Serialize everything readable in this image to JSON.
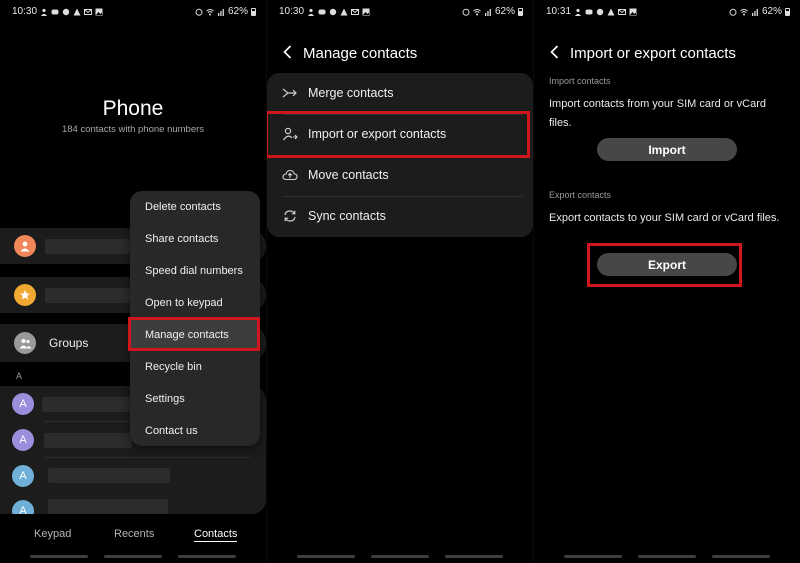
{
  "status": {
    "p1_time": "10:30",
    "p2_time": "10:30",
    "p3_time": "10:31",
    "battery": "62%"
  },
  "contacts_screen": {
    "title": "Phone",
    "subtitle": "184 contacts with phone numbers",
    "groups_label": "Groups",
    "section_letter": "A",
    "avatar_letter": "A",
    "popup_menu": {
      "items": [
        "Delete contacts",
        "Share contacts",
        "Speed dial numbers",
        "Open to keypad",
        "Manage contacts",
        "Recycle bin",
        "Settings",
        "Contact us"
      ],
      "highlighted_index": 4
    },
    "bottom_tabs": [
      "Keypad",
      "Recents",
      "Contacts"
    ],
    "active_tab": "Contacts"
  },
  "manage_contacts": {
    "title": "Manage contacts",
    "items": [
      {
        "label": "Merge contacts",
        "icon": "merge-icon"
      },
      {
        "label": "Import or export contacts",
        "icon": "import-export-icon"
      },
      {
        "label": "Move contacts",
        "icon": "cloud-upload-icon"
      },
      {
        "label": "Sync contacts",
        "icon": "sync-icon"
      }
    ]
  },
  "import_export": {
    "title": "Import or export contacts",
    "import_section_label": "Import contacts",
    "import_description": "Import contacts from your SIM card or vCard files.",
    "import_button": "Import",
    "export_section_label": "Export contacts",
    "export_description": "Export contacts to your SIM card or vCard files.",
    "export_button": "Export"
  },
  "colors": {
    "highlight_red": "#d0161c",
    "avatar_orange": "#f0875a",
    "avatar_yellow": "#f0a833",
    "avatar_gray": "#9a9a9a",
    "avatar_purple": "#9a8fdc",
    "avatar_blue": "#6fb0d8"
  }
}
